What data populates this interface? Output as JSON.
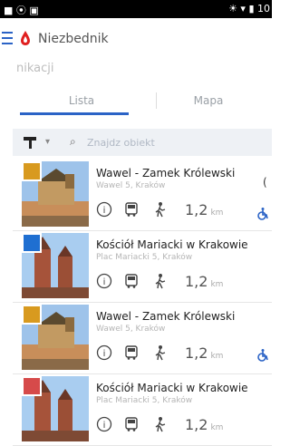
{
  "status": {
    "left": "■ ⦿ ▣",
    "right": "☀ ▾ ▮ 10"
  },
  "app": {
    "title": "Niezbednik",
    "subtitle": "nikacji"
  },
  "tabs": [
    "Lista",
    "Mapa"
  ],
  "search": {
    "placeholder": "Znajdz obiekt"
  },
  "items": [
    {
      "title": "Wawel - Zamek Królewski",
      "address": "Wawel 5, Kraków",
      "distance": "1,2",
      "unit": "km",
      "badge_color": "#d89a1f"
    },
    {
      "title": "Kościół Mariacki w Krakowie",
      "address": "Plac Mariacki 5, Kraków",
      "distance": "1,2",
      "unit": "km",
      "badge_color": "#1f6fd1"
    },
    {
      "title": "Wawel - Zamek Królewski",
      "address": "Wawel 5, Kraków",
      "distance": "1,2",
      "unit": "km",
      "badge_color": "#d89a1f"
    },
    {
      "title": "Kościół Mariacki w Krakowie",
      "address": "Plac Mariacki 5, Kraków",
      "distance": "1,2",
      "unit": "km",
      "badge_color": "#d64a4a"
    }
  ]
}
